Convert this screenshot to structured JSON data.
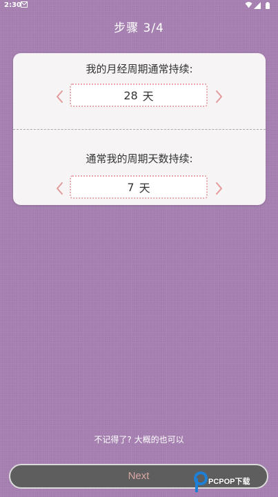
{
  "status_bar": {
    "time": "2:30",
    "icons": [
      "mail-icon",
      "wifi-icon",
      "signal-icon",
      "battery-icon"
    ]
  },
  "header": {
    "step_title": "步骤 3/4"
  },
  "card": {
    "cycle_question": "我的月经周期通常持续:",
    "cycle_value": "28",
    "cycle_unit": "天",
    "period_question": "通常我的周期天数持续:",
    "period_value": "7",
    "period_unit": "天"
  },
  "footer": {
    "hint": "不记得了? 大概的也可以",
    "next_label": "Next"
  },
  "watermark": {
    "text": "PCPOP下载"
  },
  "colors": {
    "background": "#a57fb0",
    "card": "#f6f4f4",
    "arrow": "#e29a9c",
    "button": "#5e5e5e",
    "button_text": "#d9a7a2"
  }
}
